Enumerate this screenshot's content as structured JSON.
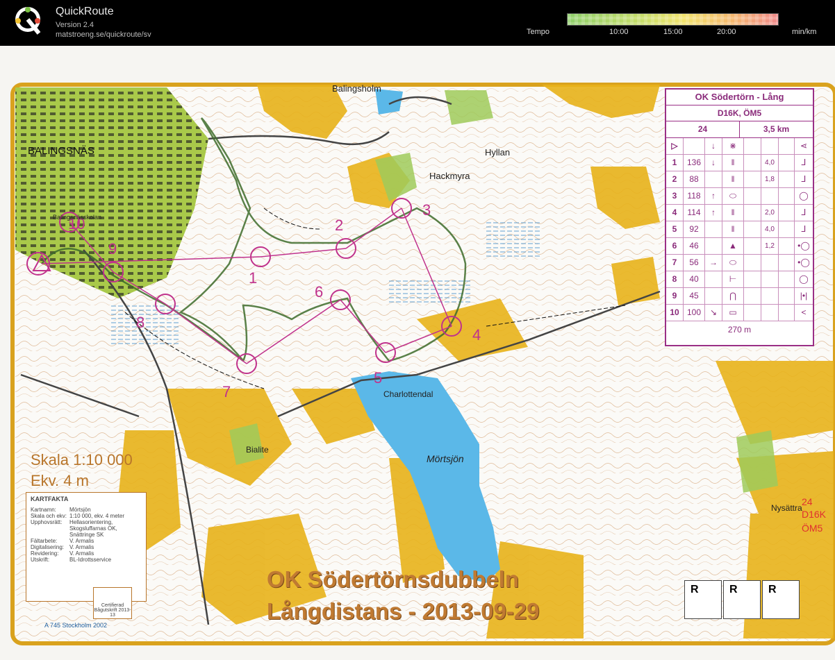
{
  "app": {
    "name": "QuickRoute",
    "version": "Version 2.4",
    "url": "matstroeng.se/quickroute/sv"
  },
  "tempo": {
    "label": "Tempo",
    "ticks": [
      "10:00",
      "15:00",
      "20:00"
    ],
    "unit": "min/km",
    "colors": [
      "#8fcf6a",
      "#c6dd69",
      "#f2e36c",
      "#f5b86e",
      "#f08a8a"
    ]
  },
  "map": {
    "place_labels": {
      "balingsholm": "Balingsholm",
      "balingsnas": "BALINGSNÄS",
      "hyllan": "Hyllan",
      "hackmyra": "Hackmyra",
      "balingsnasskolan": "Balingsnässkolan",
      "charlottendal": "Charlottendal",
      "mortsjon": "Mörtsjön",
      "bialite": "Bialite",
      "nysattra": "Nysättra"
    },
    "control_numbers": [
      "1",
      "2",
      "3",
      "4",
      "5",
      "6",
      "7",
      "8",
      "9",
      "10"
    ],
    "course_note": [
      "24",
      "D16K",
      "ÖM5"
    ],
    "colors": {
      "course": "#c0328c",
      "route": "#3d6b2a",
      "yellow": "#e8b21a",
      "green": "#a9c94a",
      "water": "#5bb8e8",
      "frame": "#d9a21e"
    }
  },
  "control_description": {
    "title": "OK Södertörn - Lång",
    "class": "D16K, ÖM5",
    "course": "24",
    "length": "3,5 km",
    "rows": [
      {
        "n": "1",
        "code": "136",
        "dir": "↓",
        "feat": "𝍪",
        "dim": "4,0",
        "pos": "⅃"
      },
      {
        "n": "2",
        "code": "88",
        "dir": "",
        "feat": "𝍪",
        "dim": "1,8",
        "pos": "⅃"
      },
      {
        "n": "3",
        "code": "118",
        "dir": "↑",
        "feat": "⬭",
        "dim": "",
        "pos": "◯"
      },
      {
        "n": "4",
        "code": "114",
        "dir": "↑",
        "feat": "𝍪",
        "dim": "2,0",
        "pos": "⅃"
      },
      {
        "n": "5",
        "code": "92",
        "dir": "",
        "feat": "𝍪",
        "dim": "4,0",
        "pos": "⅃"
      },
      {
        "n": "6",
        "code": "46",
        "dir": "",
        "feat": "▲",
        "dim": "1,2",
        "pos": "•◯"
      },
      {
        "n": "7",
        "code": "56",
        "dir": "→",
        "feat": "⬭",
        "dim": "",
        "pos": "•◯"
      },
      {
        "n": "8",
        "code": "40",
        "dir": "",
        "feat": "⊢",
        "dim": "",
        "pos": "◯"
      },
      {
        "n": "9",
        "code": "45",
        "dir": "",
        "feat": "⋂",
        "dim": "",
        "pos": "|•|"
      },
      {
        "n": "10",
        "code": "100",
        "dir": "↘",
        "feat": "▭",
        "dim": "",
        "pos": "<"
      }
    ],
    "finish": "270 m"
  },
  "legend": {
    "scale": "Skala 1:10 000",
    "equidistance": "Ekv. 4 m",
    "kartfakta_title": "KARTFAKTA",
    "kartfakta": [
      [
        "Kartnamn:",
        "Mörtsjön"
      ],
      [
        "Skala och ekv:",
        "1:10 000, ekv. 4 meter"
      ],
      [
        "Upphovsrätt:",
        "Hellasorientering,"
      ],
      [
        "",
        "Skogsluffarnas OK,"
      ],
      [
        "",
        "Snättringe SK"
      ],
      [
        "Fältarbete:",
        "V. Armalis"
      ],
      [
        "Digitalisering:",
        "V. Armalis"
      ],
      [
        "Revidering:",
        "V. Armalis"
      ],
      [
        "Utskrift:",
        "BL-Idrottsservice"
      ]
    ],
    "license": "A 745 Stockholm 2002",
    "cert": "Certifierad Bågutskrift 2013-13"
  },
  "event": {
    "title": "OK Södertörnsdubbeln",
    "subtitle": "Långdistans - 2013-09-29"
  },
  "rboxes": [
    "R",
    "R",
    "R"
  ]
}
